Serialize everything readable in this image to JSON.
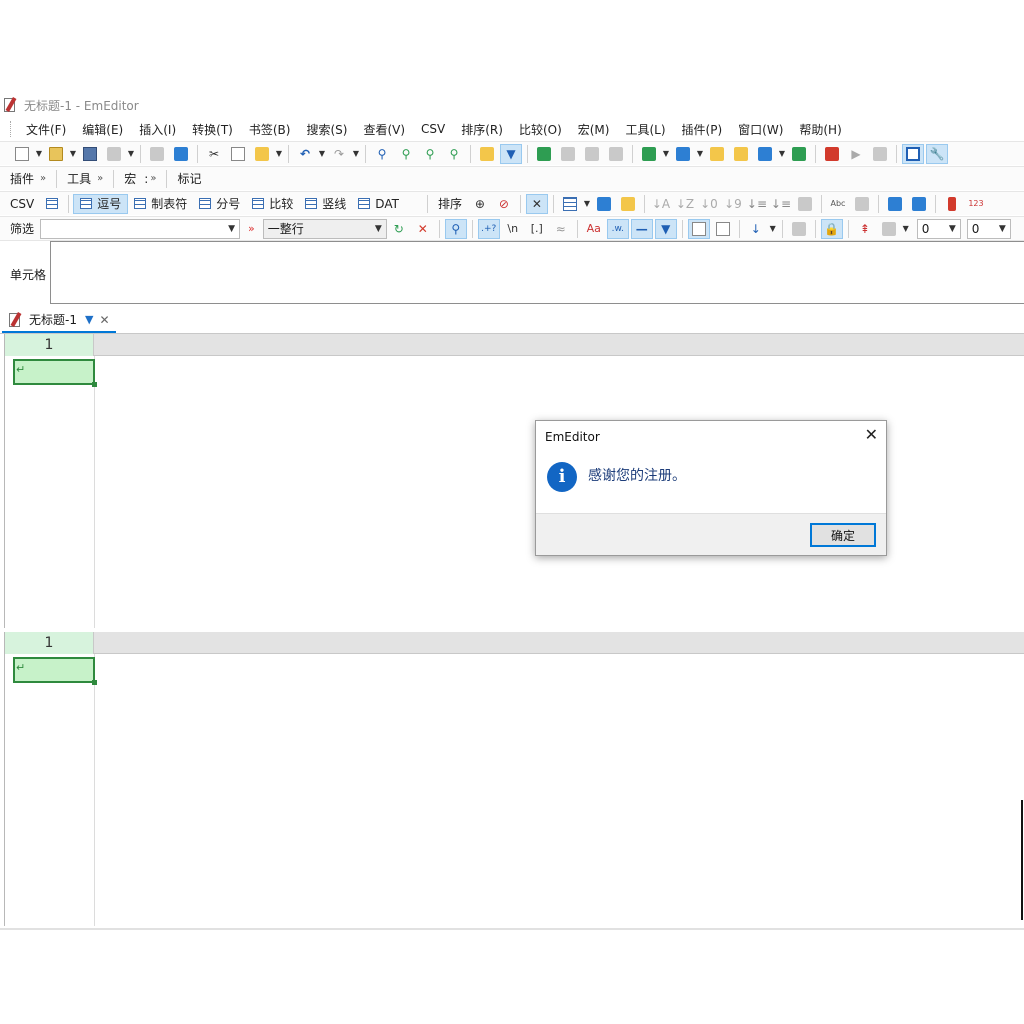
{
  "window": {
    "title": "无标题-1 - EmEditor"
  },
  "menu": [
    "文件(F)",
    "编辑(E)",
    "插入(I)",
    "转换(T)",
    "书签(B)",
    "搜索(S)",
    "查看(V)",
    "CSV",
    "排序(R)",
    "比较(O)",
    "宏(M)",
    "工具(L)",
    "插件(P)",
    "窗口(W)",
    "帮助(H)"
  ],
  "toolbar_groups": {
    "plugins": "插件",
    "tools": "工具",
    "macro": "宏",
    "marker": "标记",
    "chevron": "»"
  },
  "csv_bar": {
    "label": "CSV",
    "modes": [
      "逗号",
      "制表符",
      "分号",
      "比较",
      "竖线",
      "DAT"
    ],
    "selected_mode": "逗号",
    "sort_label": "排序",
    "escape_n": "\\n",
    "brackets": "[.]",
    "aa_label": "Aa",
    "w_label": ".w.",
    "numbers_label": "123"
  },
  "filter_bar": {
    "label": "筛选",
    "filter_value": "",
    "scope_value": "一整行",
    "spin1": "0",
    "spin2": "0",
    "regex_label": ".+?"
  },
  "cell_bar": {
    "label": "单元格",
    "value": ""
  },
  "tabs": [
    {
      "label": "无标题-1"
    }
  ],
  "panes": [
    {
      "column_header": "1"
    },
    {
      "column_header": "1"
    }
  ],
  "dialog": {
    "title": "EmEditor",
    "icon": "info-icon",
    "message": "感谢您的注册。",
    "ok_label": "确定"
  },
  "colors": {
    "accent": "#0078d7",
    "selected_cell": "#c7f2c9",
    "cell_border": "#2f8a3e",
    "info_icon": "#1266c4"
  }
}
